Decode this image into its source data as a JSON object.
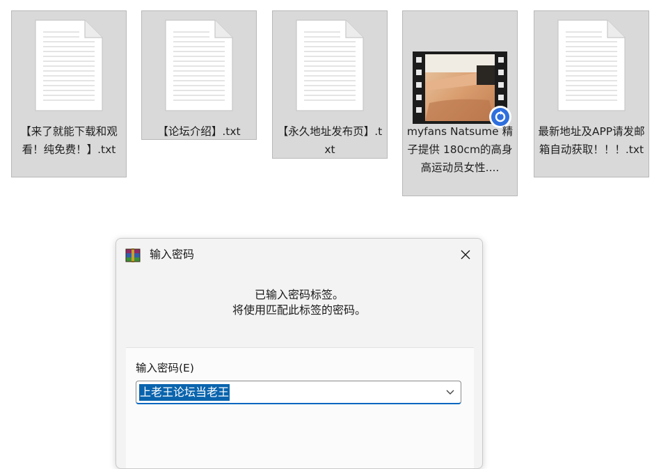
{
  "files": [
    {
      "name": "【来了就能下载和观看！纯免费！】.txt",
      "type": "text",
      "icon": "text-file-icon"
    },
    {
      "name": "【论坛介绍】.txt",
      "type": "text",
      "icon": "text-file-icon"
    },
    {
      "name": "【永久地址发布页】.txt",
      "type": "text",
      "icon": "text-file-icon"
    },
    {
      "name": "myfans Natsume 精子提供 180cm的高身高运动员女性....",
      "type": "video",
      "icon": "video-file-icon"
    },
    {
      "name": "最新地址及APP请发邮箱自动获取！！！.txt",
      "type": "text",
      "icon": "text-file-icon"
    }
  ],
  "dialog": {
    "title": "输入密码",
    "app_icon": "winrar-icon",
    "close_icon": "close-icon",
    "info_line1": "已输入密码标签。",
    "info_line2": "将使用匹配此标签的密码。",
    "field_label": "输入密码(E)",
    "password_value": "上老王论坛当老王",
    "dropdown_icon": "chevron-down-icon"
  },
  "colors": {
    "tile_bg": "#d9d9d9",
    "selection": "#0a64ad",
    "accent": "#0067c0",
    "sync_badge": "#2f6fdd"
  }
}
